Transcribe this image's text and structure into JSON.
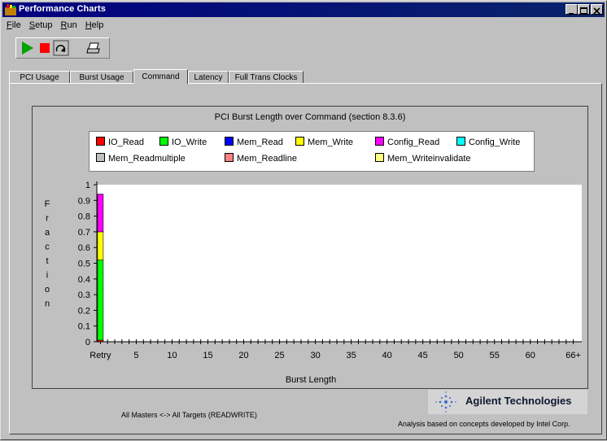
{
  "window": {
    "title": "Performance Charts"
  },
  "menu": [
    {
      "label": "File",
      "accel": "F",
      "rest": "ile"
    },
    {
      "label": "Setup",
      "accel": "S",
      "rest": "etup"
    },
    {
      "label": "Run",
      "accel": "R",
      "rest": "un"
    },
    {
      "label": "Help",
      "accel": "H",
      "rest": "elp"
    }
  ],
  "toolbar": [
    "play-icon",
    "stop-icon",
    "reset-icon",
    "print-icon"
  ],
  "tabs": [
    {
      "label": "PCI Usage",
      "active": false
    },
    {
      "label": "Burst Usage",
      "active": false
    },
    {
      "label": "Command",
      "active": true
    },
    {
      "label": "Latency",
      "active": false
    },
    {
      "label": "Full Trans Clocks",
      "active": false
    }
  ],
  "chart_data": {
    "type": "bar",
    "title": "PCI Burst Length over Command (section 8.3.6)",
    "xlabel": "Burst Length",
    "ylabel": "Fraction",
    "ylim": [
      0,
      1
    ],
    "yticks": [
      "0",
      "0.1",
      "0.2",
      "0.3",
      "0.4",
      "0.5",
      "0.6",
      "0.7",
      "0.8",
      "0.9",
      "1"
    ],
    "xticks": [
      "Retry",
      "5",
      "10",
      "15",
      "20",
      "25",
      "30",
      "35",
      "40",
      "45",
      "50",
      "55",
      "60",
      "66+"
    ],
    "stacked": true,
    "legend": [
      {
        "name": "IO_Read",
        "color": "#ff0000"
      },
      {
        "name": "IO_Write",
        "color": "#00ff00"
      },
      {
        "name": "Mem_Read",
        "color": "#0000ff"
      },
      {
        "name": "Mem_Write",
        "color": "#ffff00"
      },
      {
        "name": "Config_Read",
        "color": "#ff00ff"
      },
      {
        "name": "Config_Write",
        "color": "#00ffff"
      },
      {
        "name": "Mem_Readmultiple",
        "color": "#c0c0c0"
      },
      {
        "name": "Mem_Readline",
        "color": "#ff8080"
      },
      {
        "name": "Mem_Writeinvalidate",
        "color": "#ffff80"
      }
    ],
    "series": [
      {
        "name": "IO_Read",
        "category": "Retry",
        "value": 0.01
      },
      {
        "name": "IO_Write",
        "category": "Retry",
        "value": 0.51
      },
      {
        "name": "Mem_Write",
        "category": "Retry",
        "value": 0.18
      },
      {
        "name": "Config_Read",
        "category": "Retry",
        "value": 0.24
      }
    ],
    "grid": false
  },
  "footer": {
    "left": "All Masters <-> All Targets  (READWRITE)",
    "brand": "Agilent Technologies",
    "right": "Analysis based on concepts developed by Intel Corp."
  }
}
